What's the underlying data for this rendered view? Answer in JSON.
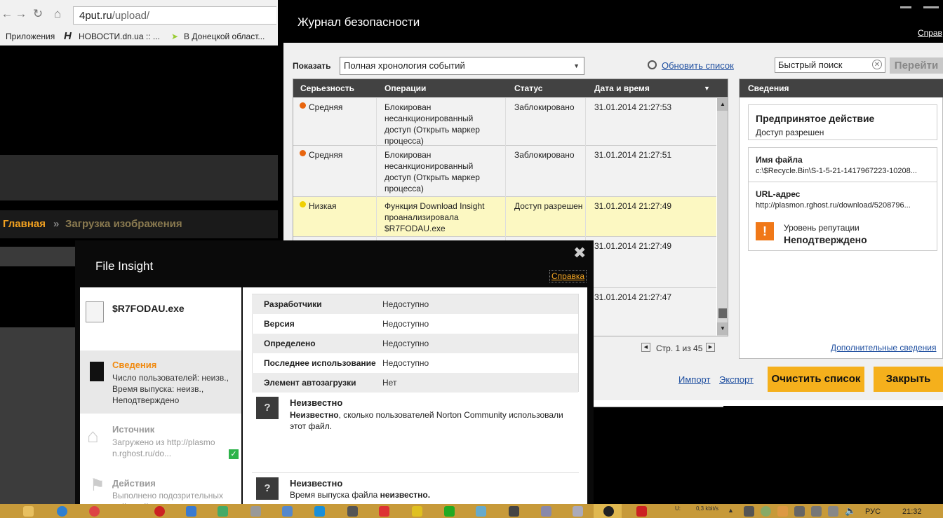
{
  "browser": {
    "url_host": "4put.ru",
    "url_path": "/upload/",
    "bookmarks": [
      "Приложения",
      "НОВОСТИ.dn.ua :: ...",
      "В Донецкой област..."
    ]
  },
  "site": {
    "breadcrumb_home": "Главная",
    "breadcrumb_sep": "»",
    "breadcrumb_current": "Загрузка изображения"
  },
  "security_log": {
    "title": "Журнал безопасности",
    "help_link": "Справ",
    "show_label": "Показать",
    "show_value": "Полная хронология событий",
    "refresh_link": "Обновить список",
    "search_placeholder": "Быстрый поиск",
    "go_button": "Перейти",
    "columns": [
      "Серьезность",
      "Операции",
      "Статус",
      "Дата и время"
    ],
    "rows": [
      {
        "severity": "Средняя",
        "operation": "Блокирован несанкционированный доступ (Открыть маркер процесса)",
        "status": "Заблокировано",
        "datetime": "31.01.2014 21:27:53"
      },
      {
        "severity": "Средняя",
        "operation": "Блокирован несанкционированный доступ (Открыть маркер процесса)",
        "status": "Заблокировано",
        "datetime": "31.01.2014 21:27:51"
      },
      {
        "severity": "Низкая",
        "operation": "Функция Download Insight проанализировала $R7FODAU.exe",
        "status": "Доступ разрешен",
        "datetime": "31.01.2014 21:27:49"
      },
      {
        "severity": "",
        "operation": "",
        "status": "",
        "datetime": "31.01.2014 21:27:49"
      },
      {
        "severity": "",
        "operation": "",
        "status": "",
        "datetime": "31.01.2014 21:27:47"
      }
    ],
    "pager": "Стр. 1 из 45",
    "details": {
      "header": "Сведения",
      "action_title": "Предпринятое действие",
      "action_value": "Доступ разрешен",
      "file_label": "Имя файла",
      "file_value": "c:\\$Recycle.Bin\\S-1-5-21-1417967223-10208...",
      "url_label": "URL-адрес",
      "url_value": "http://plasmon.rghost.ru/download/5208796...",
      "reputation_label": "Уровень репутации",
      "reputation_value": "Неподтверждено",
      "more_link": "Дополнительные сведения"
    },
    "import_link": "Импорт",
    "export_link": "Экспорт",
    "clear_button": "Очистить список",
    "close_button": "Закрыть"
  },
  "file_insight": {
    "title": "File Insight",
    "help_link": "Справка",
    "filename": "$R7FODAU.exe",
    "nav": [
      {
        "title": "Сведения",
        "desc": "Число пользователей: неизв., Время выпуска: неизв., Неподтверждено"
      },
      {
        "title": "Источник",
        "desc": "Загружено из http://plasmon.rghost.ru/do..."
      },
      {
        "title": "Действия",
        "desc": "Выполнено подозрительных действий: нет"
      }
    ],
    "properties": [
      {
        "key": "Разработчики",
        "value": "Недоступно"
      },
      {
        "key": "Версия",
        "value": "Недоступно"
      },
      {
        "key": "Определено",
        "value": "Недоступно"
      },
      {
        "key": "Последнее использование",
        "value": "Недоступно"
      },
      {
        "key": "Элемент автозагрузки",
        "value": "Нет"
      }
    ],
    "community_title": "Неизвестно",
    "community_text_bold": "Неизвестно",
    "community_text": ", сколько пользователей Norton Community использовали этот файл.",
    "release_title": "Неизвестно",
    "release_text": "Время выпуска файла ",
    "release_text_bold": "неизвестно."
  },
  "taskbar": {
    "net_rate": "0,3 kbit/s",
    "net_prefix": "U:",
    "language": "РУС",
    "clock": "21:32"
  },
  "colors": {
    "accent_orange": "#f5a623",
    "norton_yellow": "#f5b01c",
    "severity_medium": "#e8650e",
    "severity_low": "#f0d000"
  }
}
